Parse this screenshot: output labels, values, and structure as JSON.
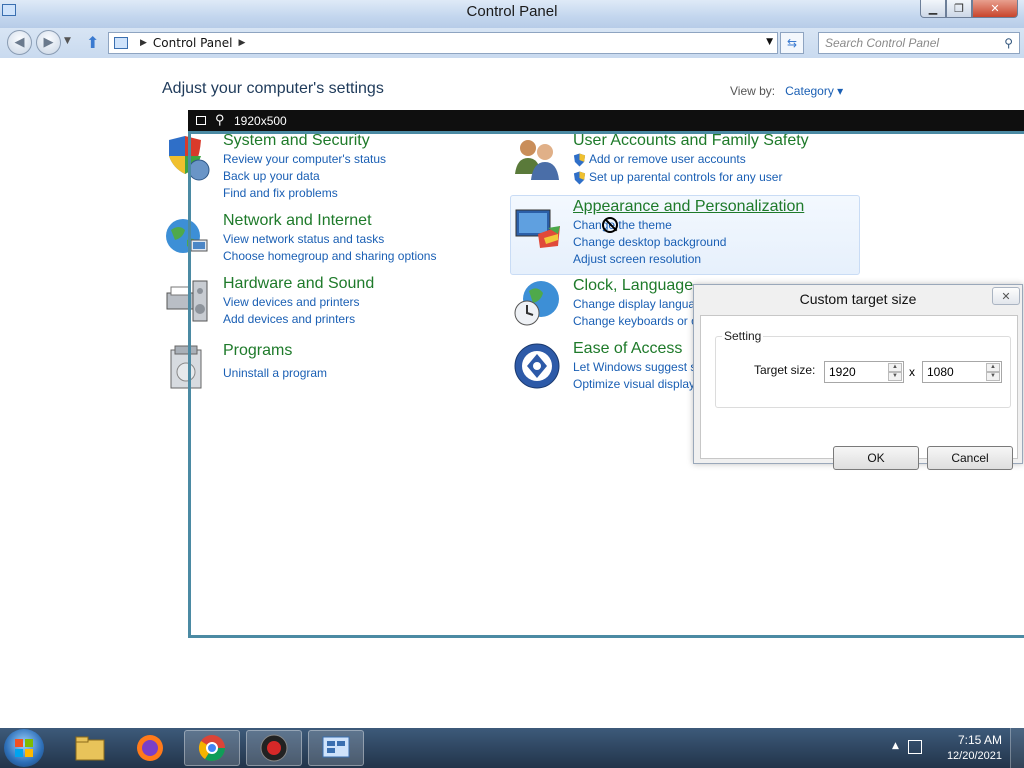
{
  "window": {
    "title": "Control Panel"
  },
  "address": {
    "path": "Control Panel",
    "search_placeholder": "Search Control Panel"
  },
  "page": {
    "title": "Adjust your computer's settings",
    "view_by_label": "View by:",
    "view_by_value": "Category"
  },
  "categories": [
    {
      "heading": "System and Security",
      "links": [
        "Review your computer's status",
        "Back up your data",
        "Find and fix problems"
      ]
    },
    {
      "heading": "Network and Internet",
      "links": [
        "View network status and tasks",
        "Choose homegroup and sharing options"
      ]
    },
    {
      "heading": "Hardware and Sound",
      "links": [
        "View devices and printers",
        "Add devices and printers"
      ]
    },
    {
      "heading": "Programs",
      "links": [
        "Uninstall a program"
      ]
    },
    {
      "heading": "User Accounts and Family Safety",
      "links": [
        "Add or remove user accounts",
        "Set up parental controls for any user"
      ]
    },
    {
      "heading": "Appearance and Personalization",
      "links": [
        "Change the theme",
        "Change desktop background",
        "Adjust screen resolution"
      ]
    },
    {
      "heading": "Clock, Language, and Region",
      "links": [
        "Change display language",
        "Change keyboards or other input methods"
      ]
    },
    {
      "heading": "Ease of Access",
      "links": [
        "Let Windows suggest settings",
        "Optimize visual display"
      ]
    }
  ],
  "capture": {
    "size_label": "1920x500"
  },
  "dialog": {
    "title": "Custom target size",
    "group_label": "Setting",
    "target_label": "Target size:",
    "width_value": "1920",
    "times": "x",
    "height_value": "1080",
    "ok": "OK",
    "cancel": "Cancel"
  },
  "taskbar": {
    "apps": [
      "file-explorer",
      "firefox",
      "chrome",
      "screen-recorder",
      "control-panel"
    ],
    "time": "7:15 AM",
    "date": "12/20/2021"
  },
  "colors": {
    "heading_green": "#1e7a2a",
    "link_blue": "#1a5fb4",
    "capture_frame": "#4b8aa3"
  }
}
